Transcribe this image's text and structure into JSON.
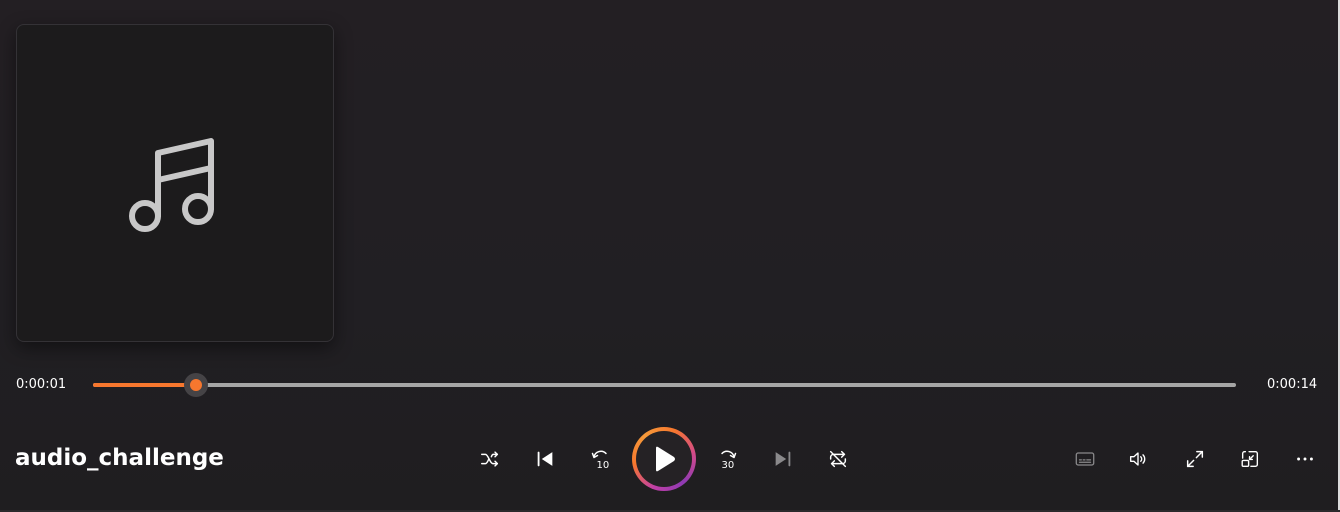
{
  "window": {
    "app": "Media Player"
  },
  "album_art": {
    "icon": "music-note-icon"
  },
  "seek": {
    "current_time": "0:00:01",
    "total_time": "0:00:14",
    "progress": 0.09
  },
  "track": {
    "title": "audio_challenge"
  },
  "controls": {
    "shuffle": "shuffle-icon",
    "previous": "previous-icon",
    "skip_back": "skip-back-10-icon",
    "play": "play-icon",
    "skip_forward": "skip-forward-30-icon",
    "next": "next-icon",
    "repeat": "repeat-icon",
    "captions": "captions-icon",
    "volume": "volume-icon",
    "fullscreen": "fullscreen-icon",
    "mini_player": "mini-player-icon",
    "more": "more-options-icon"
  },
  "colors": {
    "accent": "#f7772e",
    "background": "#221f22",
    "track": "#a6a6a6",
    "ring_gradient": [
      "#f7772e",
      "#c13fa6",
      "#8e3ab3"
    ]
  }
}
